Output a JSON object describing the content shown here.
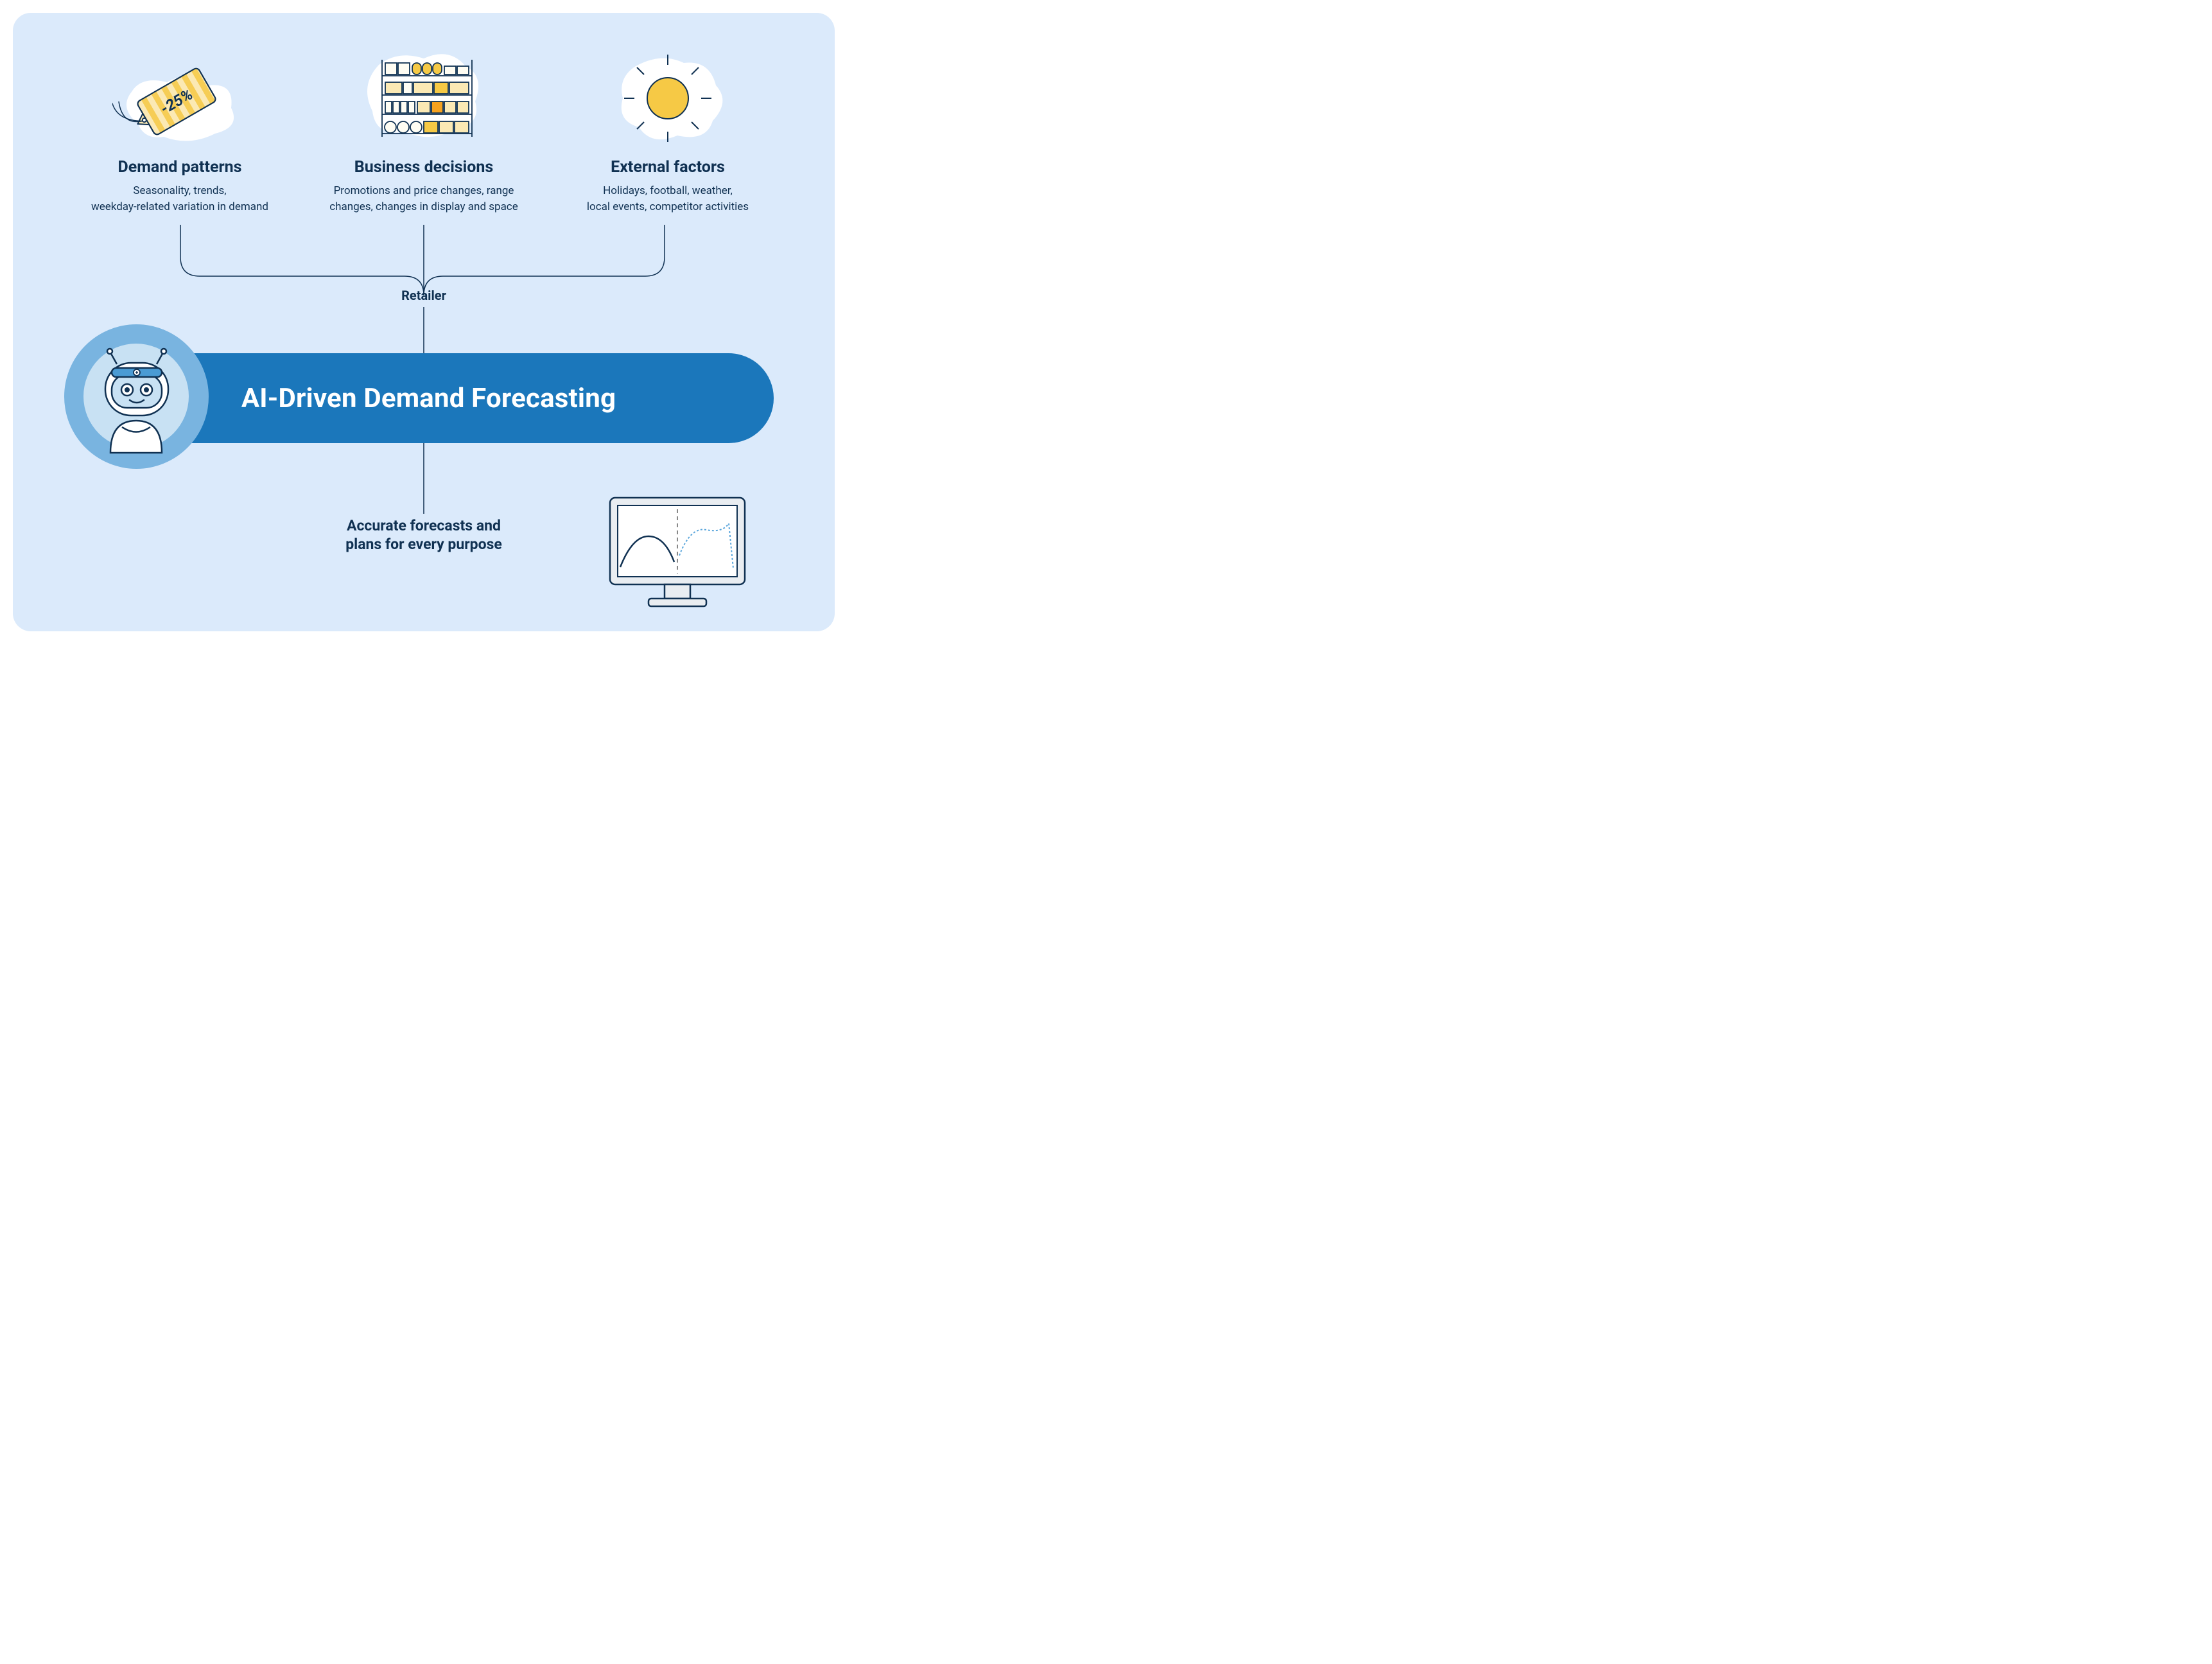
{
  "inputs": [
    {
      "title": "Demand patterns",
      "desc": "Seasonality, trends, weekday-related variation in demand",
      "icon": "price-tag-discount-icon",
      "tag_text": "-25%"
    },
    {
      "title": "Business decisions",
      "desc": "Promotions and price changes, range changes, changes in display and space",
      "icon": "store-shelves-icon"
    },
    {
      "title": "External factors",
      "desc": "Holidays, football, weather, local events, competitor activities",
      "icon": "sun-weather-icon"
    }
  ],
  "mid_label": "Retailer",
  "bar_title": "AI-Driven Demand Forecasting",
  "output_text": "Accurate forecasts and plans for every purpose",
  "colors": {
    "bg": "#dbeafb",
    "text": "#103152",
    "bar": "#1b77bb",
    "avatar": "#79b4e0",
    "accent_yellow": "#f6c945",
    "accent_yellow_light": "#fbe9b4"
  }
}
